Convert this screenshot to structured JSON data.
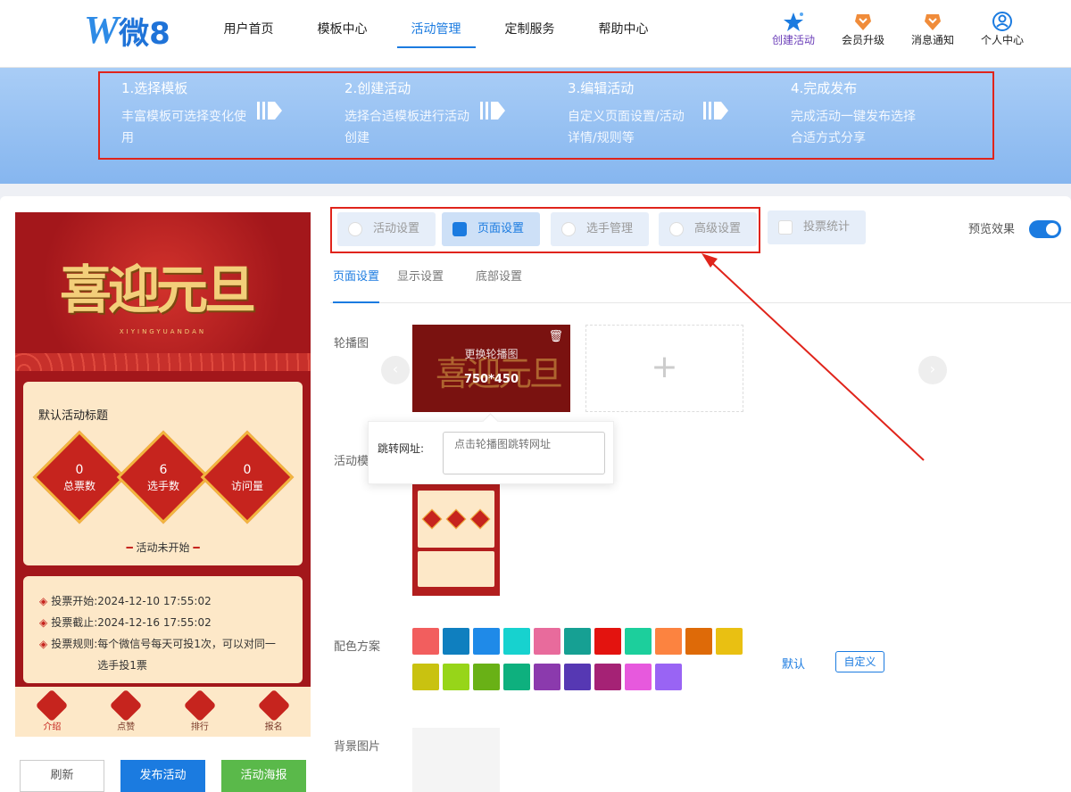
{
  "logo": {
    "mark": "W",
    "text": "微8"
  },
  "nav": [
    "用户首页",
    "模板中心",
    "活动管理",
    "定制服务",
    "帮助中心"
  ],
  "header_actions": [
    {
      "label": "创建活动",
      "icon": "star-icon"
    },
    {
      "label": "会员升级",
      "icon": "crown-icon"
    },
    {
      "label": "消息通知",
      "icon": "bell-icon"
    },
    {
      "label": "个人中心",
      "icon": "user-icon"
    }
  ],
  "steps": [
    {
      "title": "1.选择模板",
      "desc": "丰富模板可选择变化使用"
    },
    {
      "title": "2.创建活动",
      "desc": "选择合适模板进行活动创建"
    },
    {
      "title": "3.编辑活动",
      "desc": "自定义页面设置/活动详情/规则等"
    },
    {
      "title": "4.完成发布",
      "desc": "完成活动一键发布选择合适方式分享"
    }
  ],
  "preview": {
    "big_title": "喜迎元旦",
    "subtitle": "XIYINGYUANDAN",
    "activity_title": "默认活动标题",
    "stats": [
      {
        "value": "0",
        "label": "总票数"
      },
      {
        "value": "6",
        "label": "选手数"
      },
      {
        "value": "0",
        "label": "访问量"
      }
    ],
    "status": "活动未开始",
    "rules": [
      {
        "label": "投票开始:",
        "value": "2024-12-10 17:55:02"
      },
      {
        "label": "投票截止:",
        "value": "2024-12-16 17:55:02"
      },
      {
        "label": "投票规则:",
        "value": "每个微信号每天可投1次，可以对同一选手投1票"
      }
    ],
    "tabbar": [
      "介绍",
      "点赞",
      "排行",
      "报名"
    ]
  },
  "buttons": {
    "refresh": "刷新",
    "publish": "发布活动",
    "poster": "活动海报"
  },
  "settings_tabs": [
    "活动设置",
    "页面设置",
    "选手管理",
    "高级设置",
    "投票统计"
  ],
  "preview_toggle": "预览效果",
  "sub_tabs": [
    "页面设置",
    "显示设置",
    "底部设置"
  ],
  "form": {
    "carousel_label": "轮播图",
    "carousel_replace": "更换轮播图",
    "carousel_size": "750*450",
    "jump_label": "跳转网址:",
    "jump_placeholder": "点击轮播图跳转网址",
    "template_label": "活动模",
    "color_label": "配色方案",
    "color_default": "默认",
    "color_custom": "自定义",
    "bg_label": "背景图片"
  },
  "colors": [
    "#f25e5e",
    "#0f7fbf",
    "#1f8ae8",
    "#17d2cf",
    "#e86b9c",
    "#16a093",
    "#e3130f",
    "#1ccf9c",
    "#fc8340",
    "#de6a08",
    "#e9c012",
    "#c9c210",
    "#97d519",
    "#69b116",
    "#0eb07e",
    "#8b3aad",
    "#5638b3",
    "#a52275",
    "#e759dd",
    "#9964f4"
  ]
}
